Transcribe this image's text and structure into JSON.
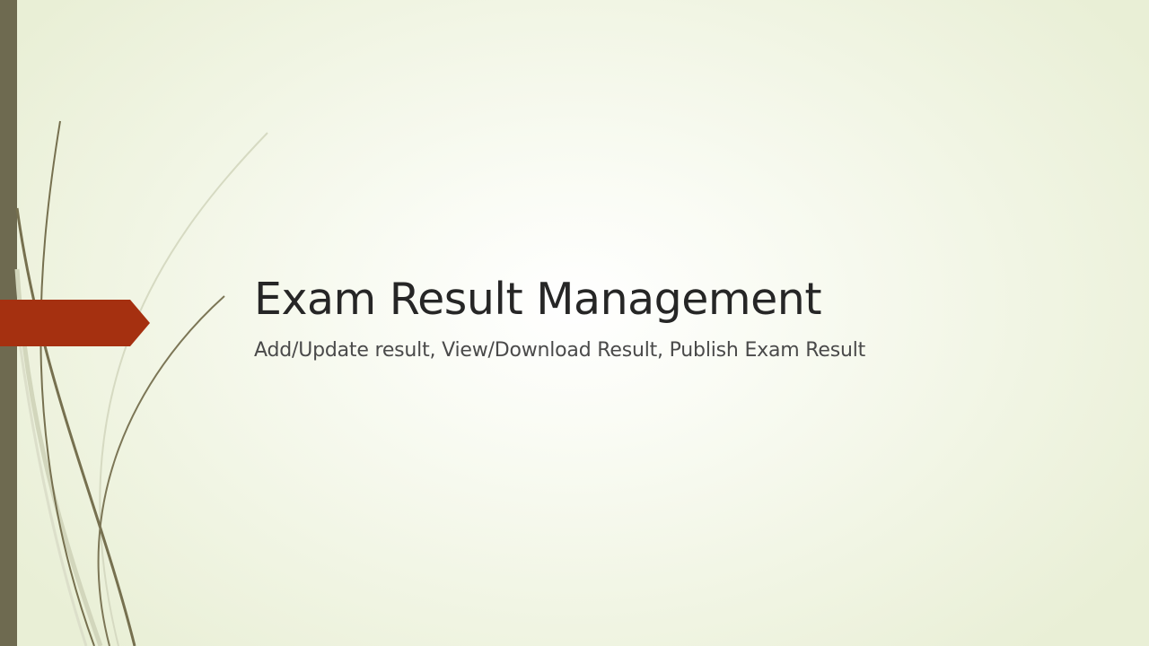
{
  "slide": {
    "title": "Exam Result Management",
    "subtitle": "Add/Update result, View/Download Result, Publish Exam Result"
  },
  "theme": {
    "background": "#f1f5e4",
    "bar_color": "#6e6a50",
    "accent_color": "#a53010",
    "title_color": "#262626",
    "subtitle_color": "#4a4a4a"
  }
}
